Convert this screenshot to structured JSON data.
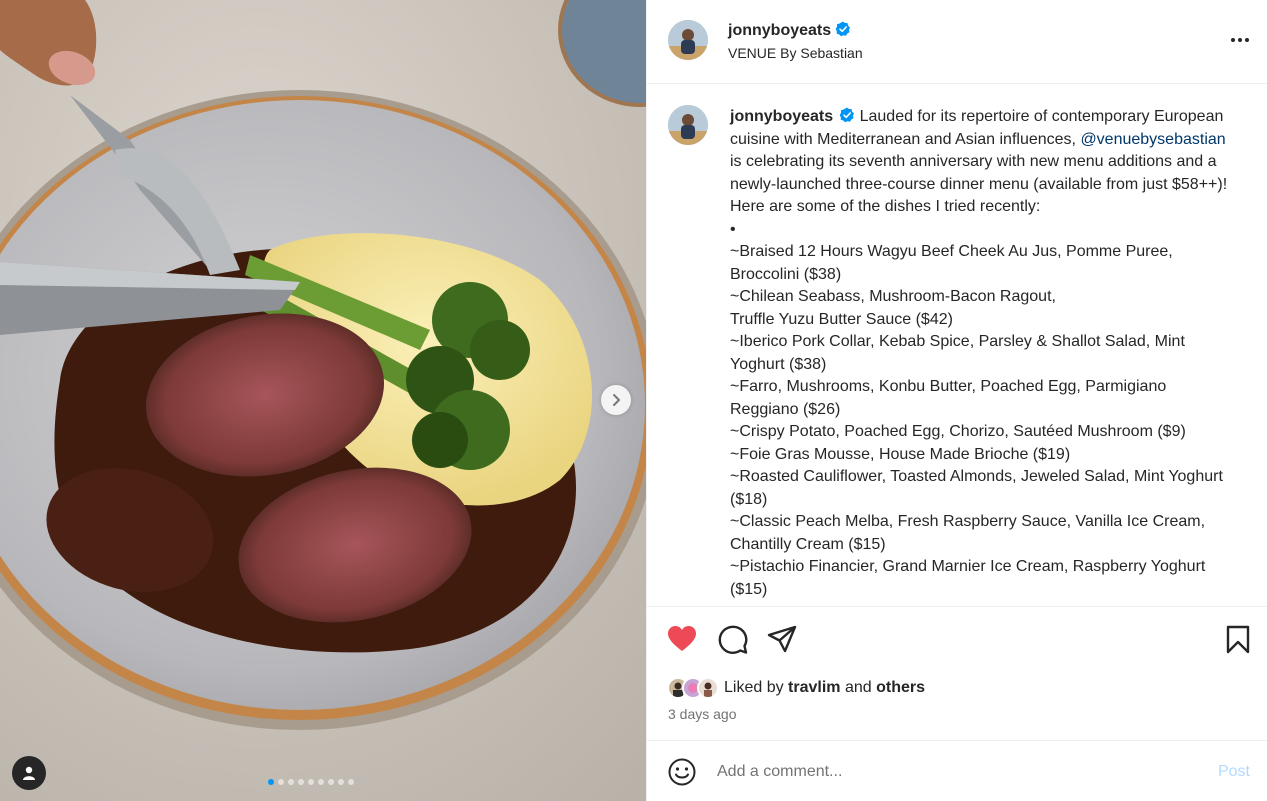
{
  "post": {
    "username": "jonnyboyeats",
    "location": "VENUE By Sebastian",
    "carousel": {
      "total_slides": 9,
      "active_slide": 1
    }
  },
  "caption": {
    "username": "jonnyboyeats",
    "intro_before_mention": "Lauded for its repertoire of contemporary European cuisine with Mediterranean and Asian influences,",
    "mention": "@venuebysebastian",
    "intro_after_mention": "is celebrating its seventh anniversary with new menu additions and a newly-launched three-course dinner menu (available from just $58++)! Here are some of the dishes I tried recently:",
    "bullet": "•",
    "dishes": [
      "~Braised 12 Hours Wagyu Beef Cheek Au Jus, Pomme Puree, Broccolini ($38)",
      "~Chilean Seabass, Mushroom-Bacon Ragout,",
      "Truffle Yuzu Butter Sauce ($42)",
      "~Iberico Pork Collar, Kebab Spice, Parsley & Shallot Salad, Mint Yoghurt ($38)",
      "~Farro, Mushrooms, Konbu Butter, Poached Egg, Parmigiano Reggiano ($26)",
      "~Crispy Potato, Poached Egg, Chorizo, Sautéed Mushroom ($9)",
      "~Foie Gras Mousse, House Made Brioche ($19)",
      "~Roasted Cauliflower, Toasted Almonds, Jeweled Salad, Mint Yoghurt ($18)",
      "~Classic Peach Melba, Fresh Raspberry Sauce, Vanilla Ice Cream, Chantilly Cream ($15)",
      "~Pistachio Financier, Grand Marnier Ice Cream, Raspberry Yoghurt ($15)"
    ]
  },
  "likes": {
    "prefix": "Liked by",
    "user": "travlim",
    "connector": "and",
    "others": "others"
  },
  "timestamp": "3 days ago",
  "comment": {
    "placeholder": "Add a comment...",
    "post_label": "Post"
  },
  "icons": {
    "like": "heart-filled-icon",
    "comment": "comment-bubble-icon",
    "share": "paper-plane-icon",
    "save": "bookmark-icon",
    "more": "more-horizontal-icon",
    "emoji": "smiley-icon",
    "next": "chevron-right-icon",
    "tags": "user-tag-icon",
    "verified": "verified-badge-icon"
  },
  "colors": {
    "like": "#ed4956",
    "verified": "#0095f6",
    "link": "#00376b",
    "post_disabled": "#b3dbff"
  }
}
